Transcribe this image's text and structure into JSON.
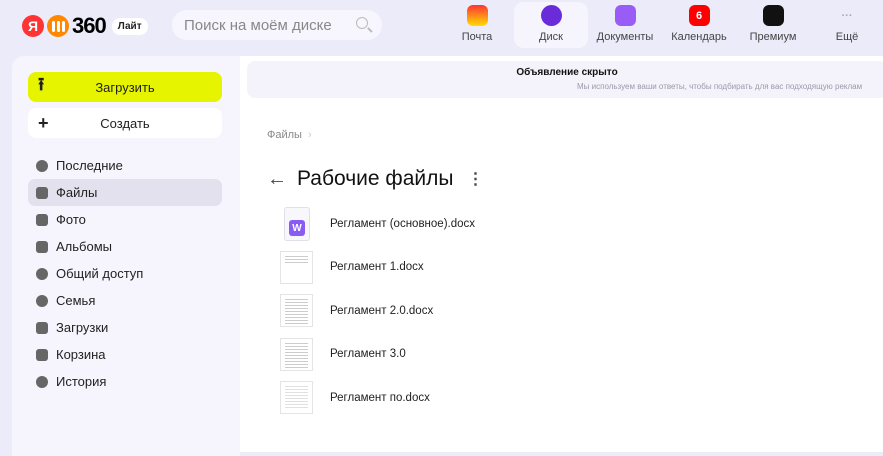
{
  "header": {
    "logo_ya": "Я",
    "logo_360": "360",
    "lite_badge": "Лайт",
    "search_placeholder": "Поиск на моём диске",
    "apps": [
      {
        "label": "Почта",
        "color": "#f5c400"
      },
      {
        "label": "Диск",
        "color": "#6a2bd9"
      },
      {
        "label": "Документы",
        "color": "#9a5cf6"
      },
      {
        "label": "Календарь",
        "color": "#f00",
        "badge": "6"
      },
      {
        "label": "Премиум",
        "color": "#111"
      },
      {
        "label": "Ещё",
        "color": ""
      }
    ]
  },
  "sidebar": {
    "upload": "Загрузить",
    "create": "Создать",
    "items": [
      {
        "label": "Последние"
      },
      {
        "label": "Файлы"
      },
      {
        "label": "Фото"
      },
      {
        "label": "Альбомы"
      },
      {
        "label": "Общий доступ"
      },
      {
        "label": "Семья"
      },
      {
        "label": "Загрузки"
      },
      {
        "label": "Корзина"
      },
      {
        "label": "История"
      }
    ]
  },
  "ad": {
    "title": "Объявление скрыто",
    "subtitle": "Мы используем ваши ответы, чтобы подбирать для вас подходящую реклам"
  },
  "breadcrumb": {
    "root": "Файлы",
    "sep": "›"
  },
  "folder": {
    "title": "Рабочие файлы",
    "more": "⋮",
    "back": "←"
  },
  "files": [
    {
      "name": "Регламент (основное).docx",
      "badge": "W"
    },
    {
      "name": "Регламент 1.docx"
    },
    {
      "name": "Регламент 2.0.docx"
    },
    {
      "name": "Регламент 3.0"
    },
    {
      "name": "Регламент по.docx"
    }
  ]
}
